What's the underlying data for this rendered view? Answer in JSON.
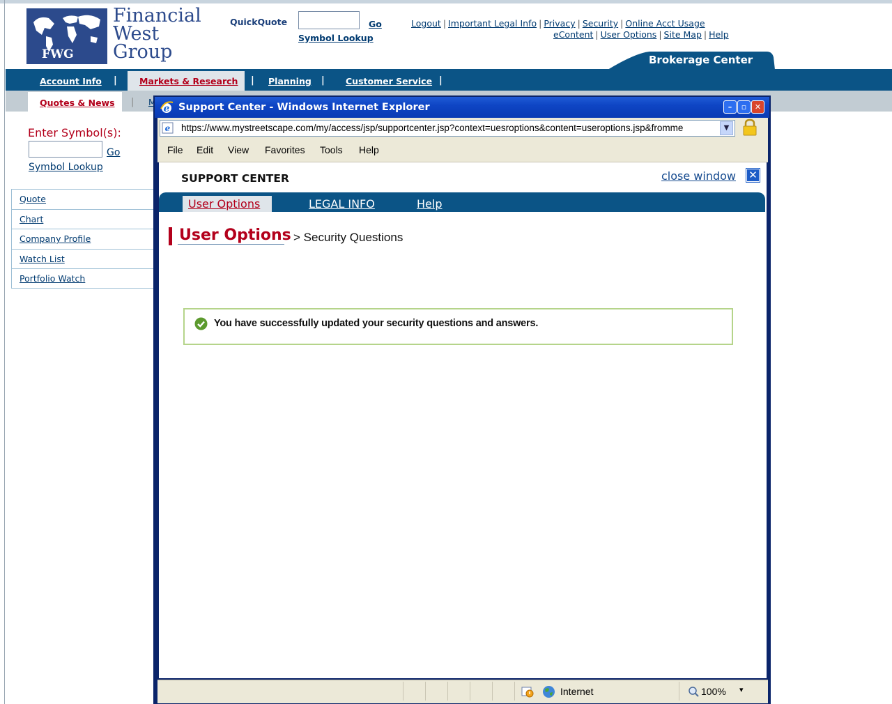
{
  "header": {
    "logo": {
      "line1": "Financial",
      "line2": "West",
      "line3": "Group",
      "abbr": "FWG"
    },
    "quickquote": {
      "label": "QuickQuote",
      "go": "Go",
      "symbol_lookup": "Symbol Lookup",
      "input_value": ""
    },
    "top_links_row1": [
      "Logout",
      "Important Legal Info",
      "Privacy",
      "Security",
      "Online Acct Usage"
    ],
    "top_links_row2": [
      "eContent",
      "User Options",
      "Site Map",
      "Help"
    ],
    "brokerage_center": "Brokerage Center"
  },
  "main_nav": {
    "items": [
      "Account Info",
      "Markets & Research",
      "Planning",
      "Customer Service"
    ],
    "active": "Markets & Research",
    "separator": "|"
  },
  "sub_nav": {
    "active": "Quotes & News",
    "partial": "M",
    "separator": "|"
  },
  "sidebar": {
    "enter_symbol": "Enter Symbol(s):",
    "go": "Go",
    "symbol_lookup": "Symbol Lookup",
    "menu": [
      "Quote",
      "Chart",
      "Company Profile",
      "Watch List",
      "Portfolio Watch"
    ]
  },
  "popup": {
    "title": "Support Center - Windows Internet Explorer",
    "window_buttons": {
      "minimize": "–",
      "restore": "▫",
      "close": "✕"
    },
    "address": "https://www.mystreetscape.com/my/access/jsp/supportcenter.jsp?context=uesroptions&content=useroptions.jsp&fromme",
    "menus": [
      "File",
      "Edit",
      "View",
      "Favorites",
      "Tools",
      "Help"
    ],
    "support_center_title": "SUPPORT CENTER",
    "close_window": "close window",
    "tabs": [
      "User Options",
      "LEGAL INFO",
      "Help"
    ],
    "active_tab": "User Options",
    "breadcrumb": {
      "main": "User Options",
      "sub": "> Security Questions"
    },
    "success_message": "You have successfully updated your security questions and answers.",
    "status": {
      "zone": "Internet",
      "zoom": "100%",
      "zoom_dropdown": "▾"
    }
  },
  "colors": {
    "nav_blue": "#0b5486",
    "accent_red": "#b3001b",
    "success_border": "#b5d48a",
    "link_blue": "#003a70",
    "titlebar_blue": "#0e45c4"
  }
}
